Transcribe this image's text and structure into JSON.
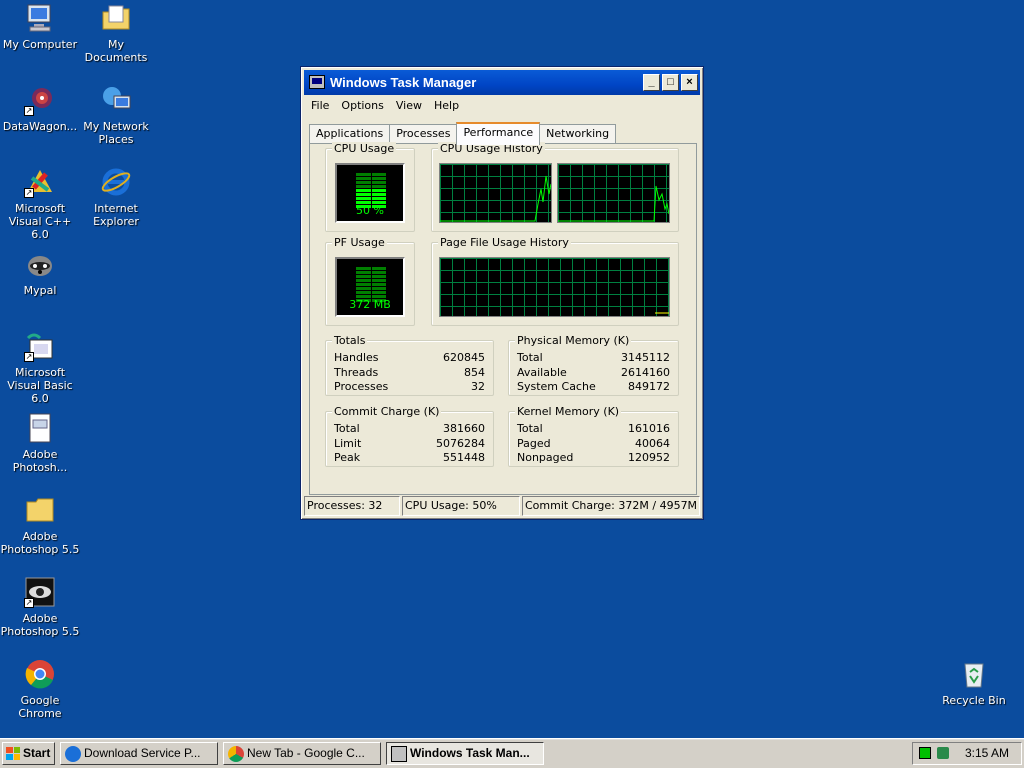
{
  "desktop": {
    "icons": [
      {
        "label": "My Computer",
        "icon": "my-computer-icon"
      },
      {
        "label": "My Documents",
        "icon": "my-documents-icon"
      },
      {
        "label": "DataWagon...",
        "icon": "datawagon-icon"
      },
      {
        "label": "My Network Places",
        "icon": "network-places-icon"
      },
      {
        "label": "Microsoft Visual C++ 6.0",
        "icon": "visual-cpp-icon"
      },
      {
        "label": "Internet Explorer",
        "icon": "internet-explorer-icon"
      },
      {
        "label": "Mypal",
        "icon": "mypal-icon"
      },
      {
        "label": "Microsoft Visual Basic 6.0",
        "icon": "visual-basic-icon"
      },
      {
        "label": "Adobe Photosh...",
        "icon": "document-icon"
      },
      {
        "label": "Adobe Photoshop 5.5",
        "icon": "folder-icon"
      },
      {
        "label": "Adobe Photoshop 5.5",
        "icon": "photoshop-icon"
      },
      {
        "label": "Google Chrome",
        "icon": "chrome-icon"
      },
      {
        "label": "Recycle Bin",
        "icon": "recycle-bin-icon"
      }
    ]
  },
  "window": {
    "title": "Windows Task Manager",
    "buttons": {
      "minimize": "_",
      "maximize": "□",
      "close": "×"
    },
    "menu": [
      "File",
      "Options",
      "View",
      "Help"
    ],
    "tabs": [
      "Applications",
      "Processes",
      "Performance",
      "Networking"
    ],
    "active_tab": "Performance",
    "cpu_usage": {
      "title": "CPU Usage",
      "value": "50 %",
      "percent": 50
    },
    "cpu_history": {
      "title": "CPU Usage History"
    },
    "pf_usage": {
      "title": "PF Usage",
      "value": "372 MB"
    },
    "pf_history": {
      "title": "Page File Usage History"
    },
    "totals": {
      "title": "Totals",
      "rows": [
        {
          "label": "Handles",
          "value": "620845"
        },
        {
          "label": "Threads",
          "value": "854"
        },
        {
          "label": "Processes",
          "value": "32"
        }
      ]
    },
    "physical_memory": {
      "title": "Physical Memory (K)",
      "rows": [
        {
          "label": "Total",
          "value": "3145112"
        },
        {
          "label": "Available",
          "value": "2614160"
        },
        {
          "label": "System Cache",
          "value": "849172"
        }
      ]
    },
    "commit_charge": {
      "title": "Commit Charge (K)",
      "rows": [
        {
          "label": "Total",
          "value": "381660"
        },
        {
          "label": "Limit",
          "value": "5076284"
        },
        {
          "label": "Peak",
          "value": "551448"
        }
      ]
    },
    "kernel_memory": {
      "title": "Kernel Memory (K)",
      "rows": [
        {
          "label": "Total",
          "value": "161016"
        },
        {
          "label": "Paged",
          "value": "40064"
        },
        {
          "label": "Nonpaged",
          "value": "120952"
        }
      ]
    },
    "status": {
      "processes": "Processes: 32",
      "cpu": "CPU Usage: 50%",
      "commit": "Commit Charge: 372M / 4957M"
    }
  },
  "taskbar": {
    "start_label": "Start",
    "tasks": [
      {
        "label": "Download Service P...",
        "icon": "internet-explorer-icon"
      },
      {
        "label": "New Tab - Google C...",
        "icon": "chrome-icon"
      },
      {
        "label": "Windows Task Man...",
        "icon": "task-manager-icon"
      }
    ],
    "clock": "3:15 AM"
  },
  "colors": {
    "desktop": "#0b4c9e",
    "meter_green": "#00ff00",
    "grid_green": "#008040"
  }
}
